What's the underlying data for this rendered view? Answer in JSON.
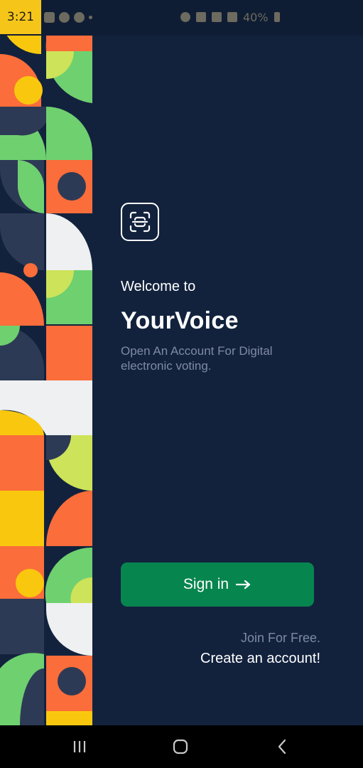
{
  "status_bar": {
    "time": "3:21",
    "battery": "40%"
  },
  "main": {
    "welcome": "Welcome to",
    "app_name": "YourVoice",
    "subtitle": "Open An Account For Digital electronic voting.",
    "signin_label": "Sign in",
    "join_text": "Join For Free.",
    "create_account": "Create an account!"
  },
  "colors": {
    "background": "#12223d",
    "accent_green": "#07854f",
    "pattern_orange": "#fb6d3a",
    "pattern_green": "#6fd06f",
    "pattern_yellow": "#f9c80e",
    "pattern_lime": "#cde35a",
    "pattern_navy": "#2d3a55",
    "pattern_white": "#eef0f1"
  },
  "icons": {
    "logo": "scan-icon",
    "signin_arrow": "arrow-right-icon",
    "nav_recents": "recents-icon",
    "nav_home": "home-icon",
    "nav_back": "back-icon"
  }
}
